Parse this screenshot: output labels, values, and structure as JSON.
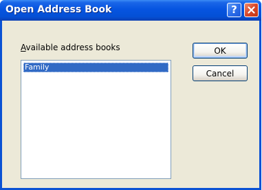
{
  "window": {
    "title": "Open Address Book"
  },
  "titlebar": {
    "help_glyph": "?",
    "help_icon": "help-icon",
    "close_icon": "close-icon"
  },
  "dialog": {
    "label_mnemonic": "A",
    "label_rest": "vailable address books",
    "list_items": [
      "Family"
    ],
    "selected_index": 0
  },
  "buttons": {
    "ok_label": "OK",
    "cancel_label": "Cancel"
  },
  "colors": {
    "titlebar": "#0654e0",
    "selection": "#316ac5",
    "client_background": "#ece9d8",
    "close_button": "#d9482a"
  }
}
